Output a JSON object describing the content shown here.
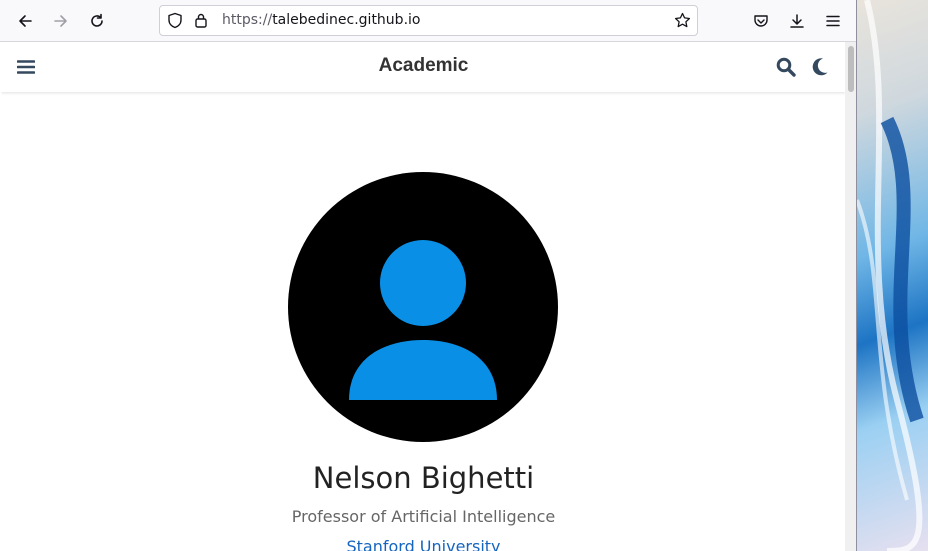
{
  "browser": {
    "url_scheme": "https://",
    "url_host": "talebedinec.github.io"
  },
  "site": {
    "brand": "Academic"
  },
  "profile": {
    "name": "Nelson Bighetti",
    "role": "Professor of Artificial Intelligence",
    "organization": "Stanford University"
  },
  "colors": {
    "avatar_bg": "#000000",
    "avatar_figure": "#0a8fe6",
    "link": "#1565c0",
    "icon": "#34495e"
  },
  "icons": {
    "back": "arrow-left-icon",
    "forward": "arrow-right-icon",
    "reload": "reload-icon",
    "tracking": "shield-icon",
    "lock": "lock-icon",
    "bookmark": "star-icon",
    "pocket": "pocket-icon",
    "downloads": "download-icon",
    "menu": "hamburger-menu-icon",
    "site_menu": "hamburger-icon",
    "search": "search-icon",
    "dark_mode": "moon-icon"
  }
}
